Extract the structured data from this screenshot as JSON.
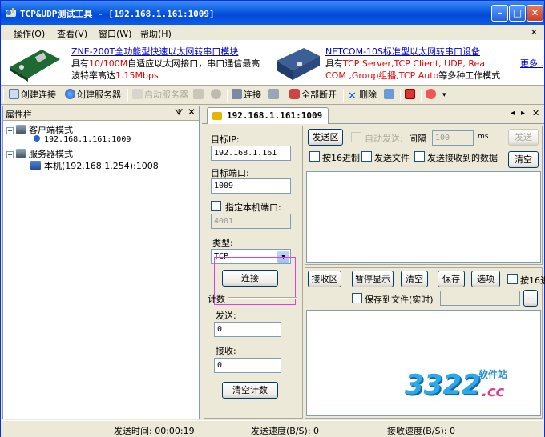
{
  "window": {
    "title": "TCP&UDP测试工具 - [192.168.1.161:1009]"
  },
  "menu": {
    "items": [
      "操作(O)",
      "查看(V)",
      "窗口(W)",
      "帮助(H)"
    ]
  },
  "banner": {
    "ad1_link": "ZNE-200T全功能型快速以太网转串口模块",
    "ad1_line1_a": "具有",
    "ad1_line1_b": "10/100M",
    "ad1_line1_c": "自适应以太网接口，串口通信最高",
    "ad1_line2_a": "波特率高达",
    "ad1_line2_b": "1.15Mbps",
    "ad2_link": "NETCOM-10S标准型以太网转串口设备",
    "ad2_line1_a": "具有",
    "ad2_line1_b": "TCP Server,TCP Client, UDP, Real",
    "ad2_line2_a": "COM ,Group组播,TCP Auto",
    "ad2_line2_b": "等多种工作模式",
    "more": "更多.."
  },
  "toolbar": {
    "create_conn": "创建连接",
    "create_server": "创建服务器",
    "start_server": "启动服务器",
    "connect": "连接",
    "disconnect_all": "全部断开",
    "delete": "删除"
  },
  "props": {
    "title": "属性栏",
    "pin": "ᗐ",
    "close": "✕",
    "client_mode": "客户端模式",
    "client_item": "192.168.1.161:1009",
    "server_mode": "服务器模式",
    "server_item": "本机(192.168.1.254):1008"
  },
  "tab": {
    "label": "192.168.1.161:1009"
  },
  "conn": {
    "target_ip_label": "目标IP:",
    "target_ip": "192.168.1.161",
    "target_port_label": "目标端口:",
    "target_port": "1009",
    "local_port_label": "指定本机端口:",
    "local_port": "4001",
    "type_label": "类型:",
    "type_value": "TCP",
    "connect_btn": "连接",
    "count_label": "计数",
    "send_label": "发送:",
    "send_count": "0",
    "recv_label": "接收:",
    "recv_count": "0",
    "clear_count_btn": "清空计数"
  },
  "send": {
    "area_btn": "发送区",
    "auto_send": "自动发送:",
    "interval": "间隔",
    "interval_value": "100",
    "ms": "ms",
    "send_btn": "发送",
    "hex": "按16进制",
    "send_file": "发送文件",
    "send_recv": "发送接收到的数据",
    "clear_btn": "清空"
  },
  "recv": {
    "area_btn": "接收区",
    "pause_btn": "暂停显示",
    "clear_btn": "清空",
    "save_btn": "保存",
    "options_btn": "选项",
    "hex": "按16进",
    "save_file": "保存到文件(实时)",
    "browse": "..."
  },
  "status": {
    "send_time": "发送时间: 00:00:19",
    "send_speed": "发送速度(B/S): 0",
    "recv_speed": "接收速度(B/S): 0"
  },
  "watermark": {
    "brand": "3322",
    "cc": ".cc",
    "site": "软件站"
  }
}
